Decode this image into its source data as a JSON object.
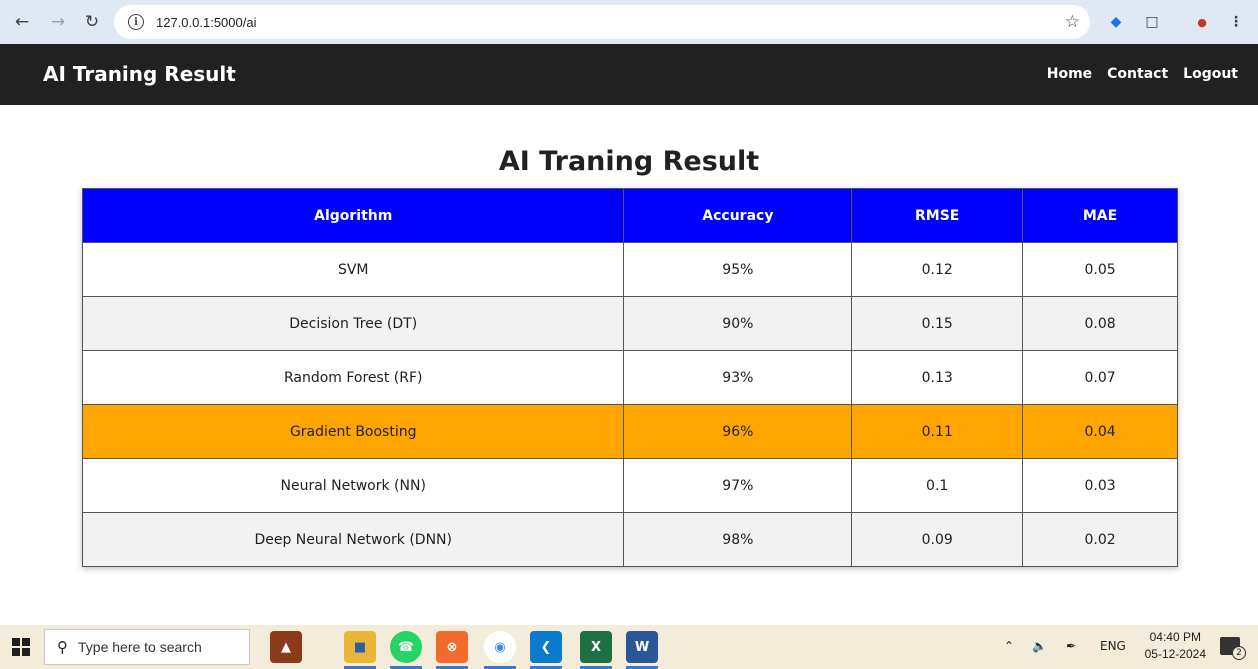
{
  "browser": {
    "url": "127.0.0.1:5000/ai"
  },
  "navbar": {
    "brand": "AI Traning Result",
    "links": [
      "Home",
      "Contact",
      "Logout"
    ]
  },
  "main": {
    "title": "AI Traning Result",
    "table": {
      "headers": [
        "Algorithm",
        "Accuracy",
        "RMSE",
        "MAE"
      ],
      "rows": [
        {
          "algorithm": "SVM",
          "accuracy": "95%",
          "rmse": "0.12",
          "mae": "0.05"
        },
        {
          "algorithm": "Decision Tree (DT)",
          "accuracy": "90%",
          "rmse": "0.15",
          "mae": "0.08"
        },
        {
          "algorithm": "Random Forest (RF)",
          "accuracy": "93%",
          "rmse": "0.13",
          "mae": "0.07"
        },
        {
          "algorithm": "Gradient Boosting",
          "accuracy": "96%",
          "rmse": "0.11",
          "mae": "0.04"
        },
        {
          "algorithm": "Neural Network (NN)",
          "accuracy": "97%",
          "rmse": "0.1",
          "mae": "0.03"
        },
        {
          "algorithm": "Deep Neural Network (DNN)",
          "accuracy": "98%",
          "rmse": "0.09",
          "mae": "0.02"
        }
      ],
      "highlight_row_index": 3
    }
  },
  "colors": {
    "header_bg": "#0000ff",
    "highlight": "#ffa500",
    "navbar_bg": "#212121"
  },
  "taskbar": {
    "search_placeholder": "Type here to search",
    "language": "ENG",
    "time": "04:40 PM",
    "date": "05-12-2024",
    "notification_count": "2"
  }
}
